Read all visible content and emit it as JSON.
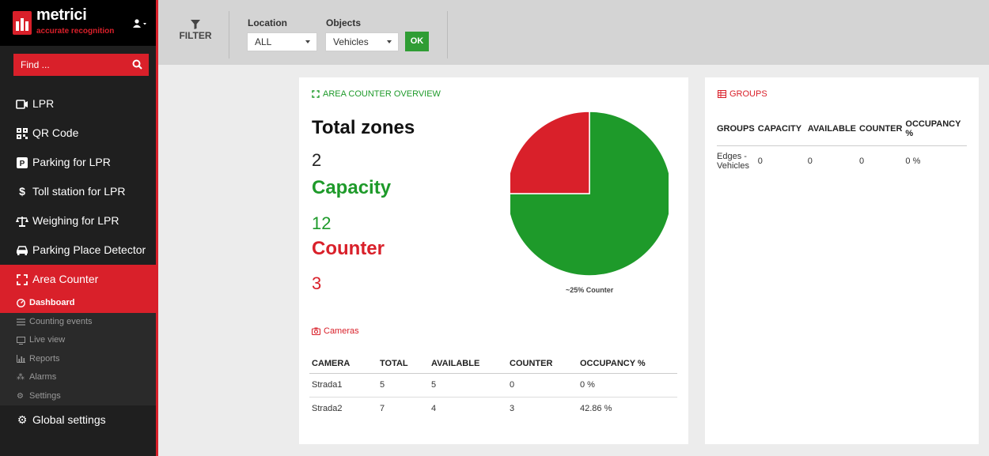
{
  "brand": {
    "name": "metrici",
    "tagline": "accurate recognition"
  },
  "search": {
    "placeholder": "Find ..."
  },
  "nav": {
    "items": [
      {
        "label": "LPR",
        "icon": "camera-icon"
      },
      {
        "label": "QR Code",
        "icon": "qrcode-icon"
      },
      {
        "label": "Parking for LPR",
        "icon": "parking-icon"
      },
      {
        "label": "Toll station for LPR",
        "icon": "dollar-icon"
      },
      {
        "label": "Weighing for LPR",
        "icon": "scale-icon"
      },
      {
        "label": "Parking Place Detector",
        "icon": "car-icon"
      },
      {
        "label": "Area Counter",
        "icon": "area-icon"
      }
    ],
    "sub_items": [
      {
        "label": "Dashboard",
        "icon": "dashboard-icon"
      },
      {
        "label": "Counting events",
        "icon": "list-icon"
      },
      {
        "label": "Live view",
        "icon": "monitor-icon"
      },
      {
        "label": "Reports",
        "icon": "chart-icon"
      },
      {
        "label": "Alarms",
        "icon": "alarm-icon"
      },
      {
        "label": "Settings",
        "icon": "gear-icon"
      }
    ],
    "global": {
      "label": "Global settings",
      "icon": "cogs-icon"
    }
  },
  "filter": {
    "label": "FILTER",
    "location_label": "Location",
    "location_value": "ALL",
    "objects_label": "Objects",
    "objects_value": "Vehicles",
    "ok_label": "OK"
  },
  "overview": {
    "title": "AREA COUNTER OVERVIEW",
    "total_zones_label": "Total zones",
    "total_zones_value": "2",
    "capacity_label": "Capacity",
    "capacity_value": "12",
    "counter_label": "Counter",
    "counter_value": "3",
    "pie_caption": "~25% Counter",
    "pie_fraction": 0.25,
    "colors": {
      "available": "#1e9a2a",
      "counter": "#d9202a"
    }
  },
  "cameras": {
    "title": "Cameras",
    "headers": [
      "CAMERA",
      "TOTAL",
      "AVAILABLE",
      "COUNTER",
      "OCCUPANCY %"
    ],
    "rows": [
      [
        "Strada1",
        "5",
        "5",
        "0",
        "0 %"
      ],
      [
        "Strada2",
        "7",
        "4",
        "3",
        "42.86 %"
      ]
    ]
  },
  "groups": {
    "title": "GROUPS",
    "headers": [
      "GROUPS",
      "CAPACITY",
      "AVAILABLE",
      "COUNTER",
      "OCCUPANCY %"
    ],
    "rows": [
      [
        "Edges - Vehicles",
        "0",
        "0",
        "0",
        "0 %"
      ]
    ]
  }
}
